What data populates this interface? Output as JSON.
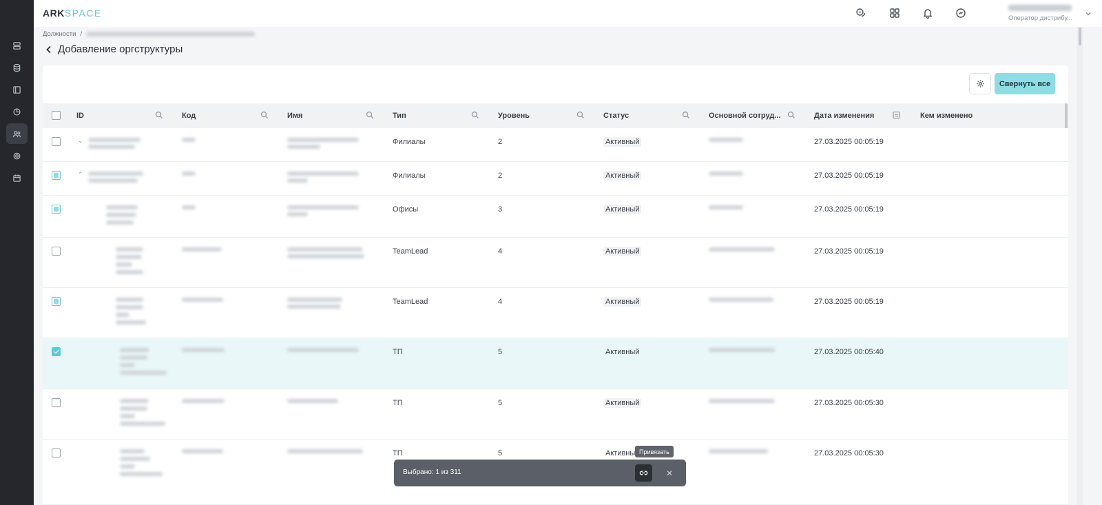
{
  "app": {
    "logo_main": "ARK",
    "logo_accent": "SPACE"
  },
  "header": {
    "user_role": "Оператор дистрибу...",
    "icons": [
      "chat-icon",
      "apps-grid-icon",
      "bell-icon",
      "sync-icon"
    ]
  },
  "sidebar": {
    "icons": [
      "server-icon",
      "database-icon",
      "layout-icon",
      "chart-pie-icon",
      "users-icon",
      "settings-icon",
      "calendar-icon"
    ],
    "active_index": 4
  },
  "breadcrumb": {
    "root": "Должности",
    "separator": "/"
  },
  "page": {
    "title": "Добавление оргструктуры"
  },
  "toolbar": {
    "collapse_label": "Свернуть все"
  },
  "table": {
    "columns": [
      "ID",
      "Код",
      "Имя",
      "Тип",
      "Уровень",
      "Статус",
      "Основной сотруд...",
      "Дата изменения",
      "Кем изменено"
    ],
    "rows": [
      {
        "type": "Филиалы",
        "level": "2",
        "status": "Активный",
        "date": "27.03.2025 00:05:19",
        "checkbox": "unchecked",
        "expander": "⌄"
      },
      {
        "type": "Филиалы",
        "level": "2",
        "status": "Активный",
        "date": "27.03.2025 00:05:19",
        "checkbox": "partial",
        "expander": "⌃"
      },
      {
        "type": "Офисы",
        "level": "3",
        "status": "Активный",
        "date": "27.03.2025 00:05:19",
        "checkbox": "partial",
        "expander": ""
      },
      {
        "type": "TeamLead",
        "level": "4",
        "status": "Активный",
        "date": "27.03.2025 00:05:19",
        "checkbox": "unchecked",
        "expander": ""
      },
      {
        "type": "TeamLead",
        "level": "4",
        "status": "Активный",
        "date": "27.03.2025 00:05:19",
        "checkbox": "partial",
        "expander": ""
      },
      {
        "type": "ТП",
        "level": "5",
        "status": "Активный",
        "date": "27.03.2025 00:05:40",
        "checkbox": "checked",
        "expander": ""
      },
      {
        "type": "ТП",
        "level": "5",
        "status": "Активный",
        "date": "27.03.2025 00:05:30",
        "checkbox": "unchecked",
        "expander": ""
      },
      {
        "type": "ТП",
        "level": "5",
        "status": "Активный",
        "date": "27.03.2025 00:05:30",
        "checkbox": "unchecked",
        "expander": ""
      }
    ]
  },
  "action_bar": {
    "selected_text": "Выбрано: 1 из 311",
    "tooltip": "Привязать",
    "close_glyph": "✕"
  },
  "colors": {
    "accent": "#5ec9d3",
    "button_bg": "#8fdce4",
    "sidebar_bg": "#25272c",
    "selected_row": "#e9f7f8"
  }
}
